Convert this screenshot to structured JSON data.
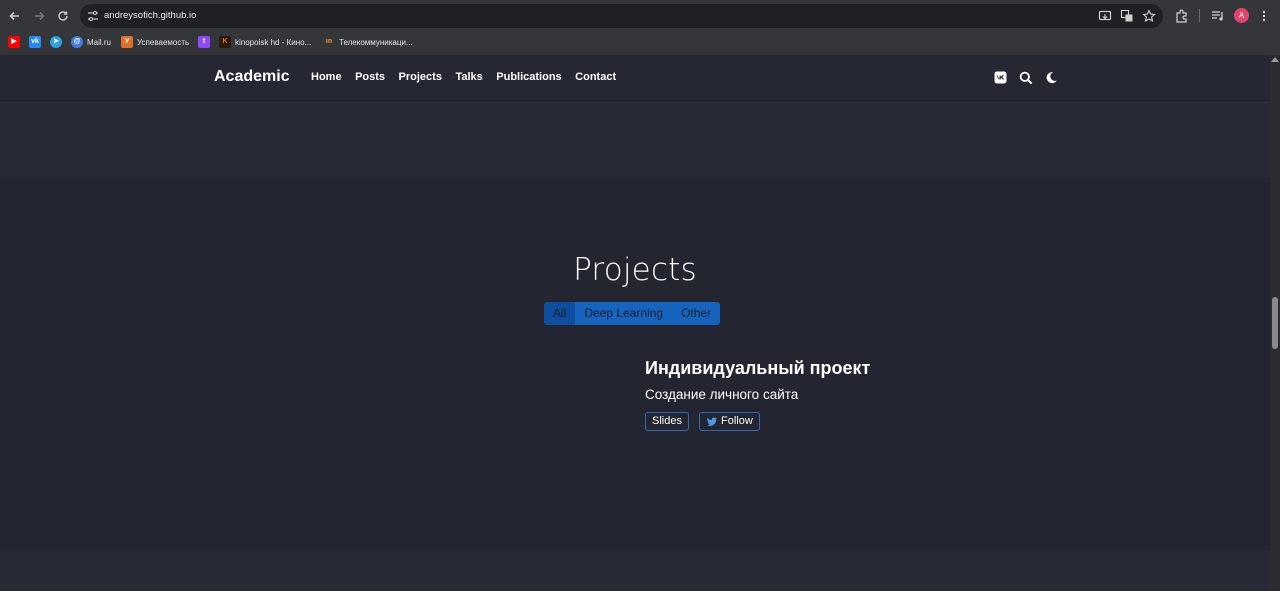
{
  "browser": {
    "url": "andreysofich.github.io",
    "bookmarks": [
      {
        "label": "",
        "icon": "youtube-icon",
        "color": "#ff0000"
      },
      {
        "label": "",
        "icon": "vk-icon",
        "color": "#2787f5"
      },
      {
        "label": "",
        "icon": "telegram-icon",
        "color": "#2aa3e0"
      },
      {
        "label": "Mail.ru",
        "icon": "mailru-icon",
        "color": "#3f7de0"
      },
      {
        "label": "Успеваемость",
        "icon": "usp-icon",
        "color": "#e0702a"
      },
      {
        "label": "",
        "icon": "twitch-icon",
        "color": "#9147ff"
      },
      {
        "label": "kinopoisk hd - Кино...",
        "icon": "kinopoisk-icon",
        "color": "#f26a1b"
      },
      {
        "label": "Телекоммуникаци...",
        "icon": "telecom-icon",
        "color": "#f29a1b"
      }
    ],
    "avatar_letter": "A"
  },
  "site": {
    "brand": "Academic",
    "menu": [
      "Home",
      "Posts",
      "Projects",
      "Talks",
      "Publications",
      "Contact"
    ]
  },
  "projects": {
    "title": "Projects",
    "filters": [
      "All",
      "Deep Learning",
      "Other"
    ],
    "active_filter": "All",
    "item": {
      "title": "Индивидуальный проект",
      "subtitle": "Создание личного сайта",
      "buttons": [
        "Slides",
        "Follow"
      ]
    }
  },
  "colors": {
    "accent": "#1565c0",
    "background": "#252733"
  }
}
